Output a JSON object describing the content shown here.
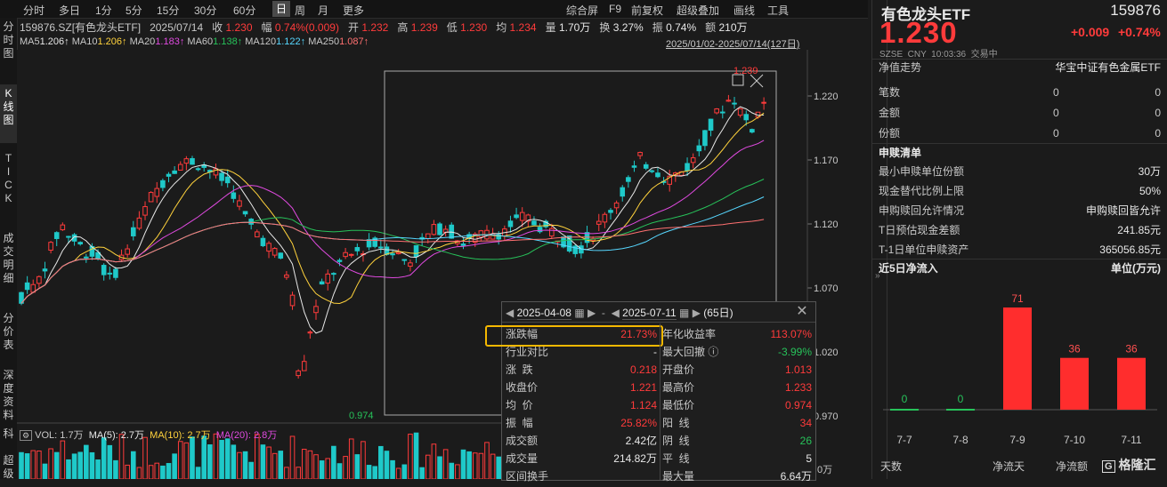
{
  "toolbar": {
    "left_items": [
      "分时",
      "多日",
      "1分",
      "5分",
      "15分",
      "30分",
      "60分",
      "日",
      "周",
      "月",
      "更多"
    ],
    "active": "日",
    "right_items": [
      "综合屏",
      "F9",
      "前复权",
      "超级叠加",
      "画线",
      "工具"
    ]
  },
  "left_tabs": [
    "分\n时\n图",
    "K\n线\n图",
    "T\nI\nC\nK",
    "成\n交\n明\n细",
    "分\n价\n表",
    "深\n度\n资\n料",
    "科",
    "超\n级"
  ],
  "stock_line": {
    "code_name": "159876.SZ[有色龙头ETF]",
    "date": "2025/07/14",
    "close_label": "收",
    "close": "1.230",
    "change_label": "幅",
    "change": "0.74%(0.009)",
    "open_label": "开",
    "open": "1.232",
    "high_label": "高",
    "high": "1.239",
    "low_label": "低",
    "low": "1.230",
    "avg_label": "均",
    "avg": "1.234",
    "vol_label": "量",
    "vol": "1.70万",
    "turn_label": "换",
    "turn": "3.27%",
    "amp_label": "振",
    "amp": "0.74%",
    "amt_label": "额",
    "amt": "210万"
  },
  "ma_line": [
    {
      "label": "MA5",
      "value": "1.206↑",
      "color": "#e8e8e8"
    },
    {
      "label": "MA10",
      "value": "1.206↑",
      "color": "#ffd23c"
    },
    {
      "label": "MA20",
      "value": "1.183↑",
      "color": "#e04ae0"
    },
    {
      "label": "MA60",
      "value": "1.138↑",
      "color": "#27c25a"
    },
    {
      "label": "MA120",
      "value": "1.122↑",
      "color": "#57d7ff"
    },
    {
      "label": "MA250",
      "value": "1.087↑",
      "color": "#ff7070"
    }
  ],
  "date_range": "2025/01/02-2025/07/14(127日)",
  "price_axis": [
    "1.220",
    "1.170",
    "1.120",
    "1.070",
    "1.020",
    "0.970"
  ],
  "chart_markers": {
    "high": "1.239",
    "low": "0.974"
  },
  "vol_line": {
    "vol_label": "VOL: 1.7万",
    "ma5": "MA(5): 2.7万",
    "ma10": "MA(10): 2.7万",
    "ma20": "MA(20): 2.8万",
    "axis": "0万"
  },
  "stats_panel": {
    "start_date": "2025-04-08",
    "end_date": "2025-07-11",
    "days": "(65日)",
    "rows_left": [
      {
        "label": "涨跌幅",
        "value": "21.73%",
        "color": "red"
      },
      {
        "label": "行业对比",
        "value": "-",
        "color": "white"
      },
      {
        "label": "涨  跌",
        "value": "0.218",
        "color": "red"
      },
      {
        "label": "收盘价",
        "value": "1.221",
        "color": "red"
      },
      {
        "label": "均  价",
        "value": "1.124",
        "color": "red"
      },
      {
        "label": "振  幅",
        "value": "25.82%",
        "color": "red"
      },
      {
        "label": "成交额",
        "value": "2.42亿",
        "color": "white"
      },
      {
        "label": "成交量",
        "value": "214.82万",
        "color": "white"
      },
      {
        "label": "区间换手",
        "value": "",
        "color": "white"
      }
    ],
    "rows_right": [
      {
        "label": "年化收益率",
        "value": "113.07%",
        "color": "red"
      },
      {
        "label": "最大回撤",
        "value": "-3.99%",
        "color": "green"
      },
      {
        "label": "开盘价",
        "value": "1.013",
        "color": "red"
      },
      {
        "label": "最高价",
        "value": "1.233",
        "color": "red"
      },
      {
        "label": "最低价",
        "value": "0.974",
        "color": "red"
      },
      {
        "label": "阳  线",
        "value": "34",
        "color": "red"
      },
      {
        "label": "阴  线",
        "value": "26",
        "color": "green"
      },
      {
        "label": "平  线",
        "value": "5",
        "color": "white"
      },
      {
        "label": "最大量",
        "value": "6.64万",
        "color": "white"
      }
    ]
  },
  "right_panel": {
    "name": "有色龙头ETF",
    "code": "159876",
    "price": "1.230",
    "change": "+0.009",
    "change_pct": "+0.74%",
    "sub_info": "SZSE  CNY  10:03:36  交易中",
    "nav_label": "净值走势",
    "nav_right": "华宝中证有色金属ETF",
    "rows_top": [
      {
        "label": "笔数",
        "v1": "0",
        "v2": "0"
      },
      {
        "label": "金额",
        "v1": "0",
        "v2": "0"
      },
      {
        "label": "份额",
        "v1": "0",
        "v2": "0"
      }
    ],
    "section_title": "申赎清单",
    "rows_mid": [
      {
        "label": "最小申赎单位份额",
        "value": "30万"
      },
      {
        "label": "现金替代比例上限",
        "value": "50%"
      },
      {
        "label": "申购赎回允许情况",
        "value": "申购赎回皆允许"
      },
      {
        "label": "T日预估现金差额",
        "value": "241.85元"
      },
      {
        "label": "T-1日单位申赎资产",
        "value": "365056.85元"
      }
    ],
    "flow_title": "近5日净流入",
    "flow_unit": "单位(万元)",
    "footer": [
      "天数",
      "净流天",
      "净流额"
    ],
    "watermark": "格隆汇"
  },
  "chart_data": {
    "type": "bar",
    "categories": [
      "7-7",
      "7-8",
      "7-9",
      "7-10",
      "7-11"
    ],
    "values": [
      0,
      0,
      71,
      36,
      36
    ],
    "title": "近5日净流入",
    "ylabel": "单位(万元)"
  },
  "colors": {
    "up": "#ff3b3b",
    "down": "#1fc9c9",
    "highlight": "#f5b800"
  }
}
